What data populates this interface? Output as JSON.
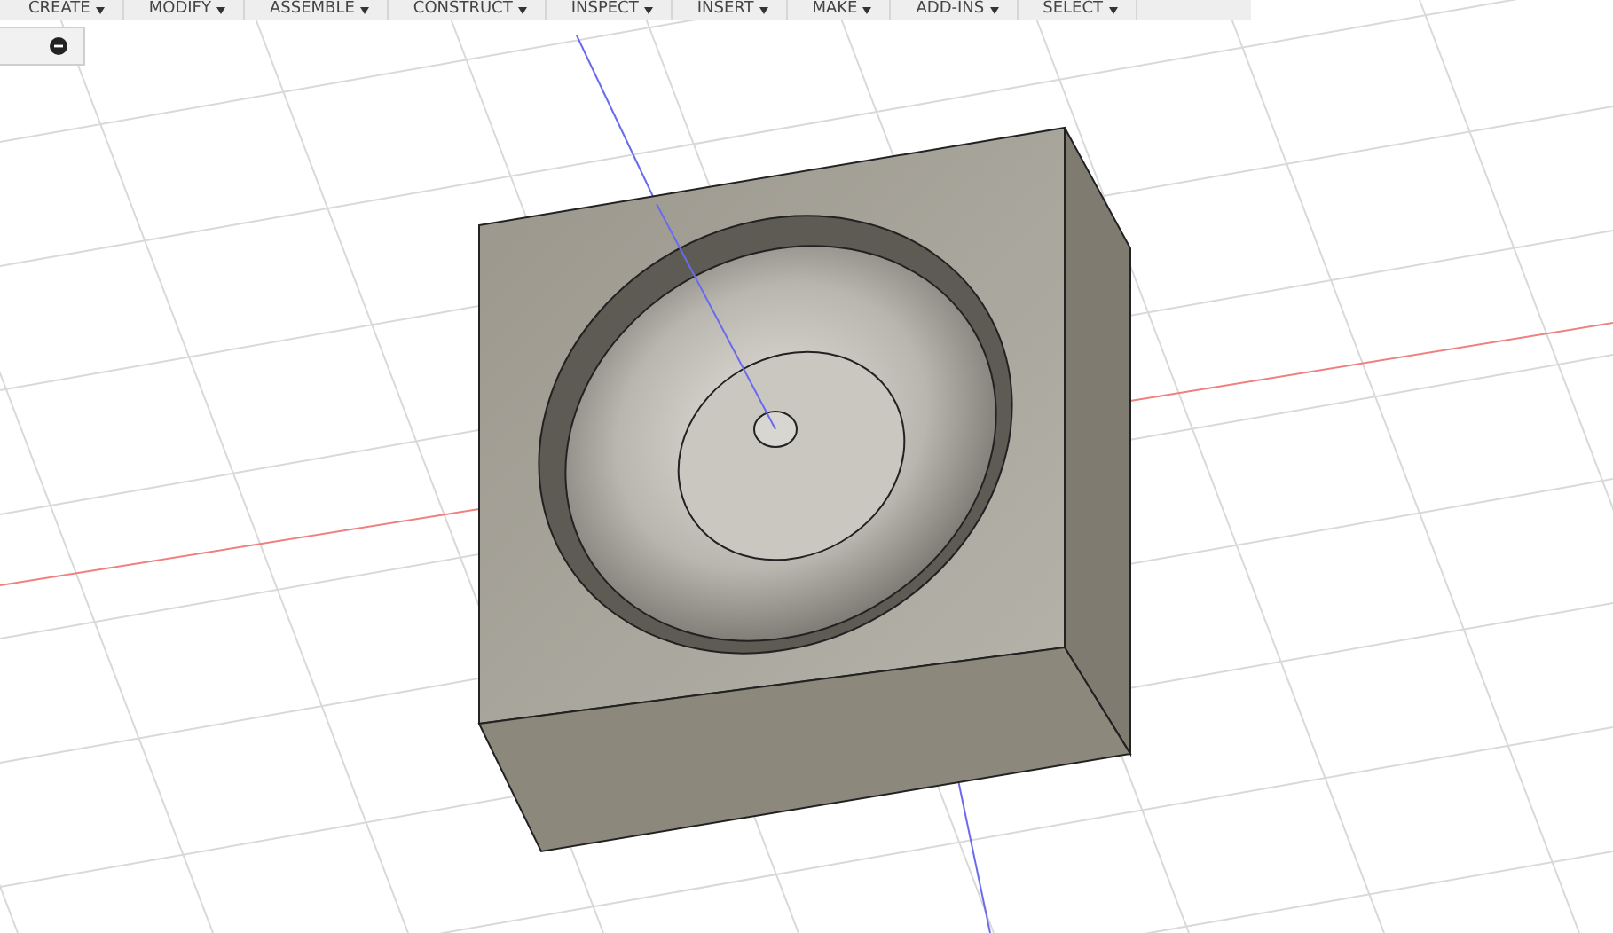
{
  "toolbar": {
    "menus": [
      {
        "label": "CREATE"
      },
      {
        "label": "MODIFY"
      },
      {
        "label": "ASSEMBLE"
      },
      {
        "label": "CONSTRUCT"
      },
      {
        "label": "INSPECT"
      },
      {
        "label": "INSERT"
      },
      {
        "label": "MAKE"
      },
      {
        "label": "ADD-INS"
      },
      {
        "label": "SELECT"
      }
    ]
  }
}
